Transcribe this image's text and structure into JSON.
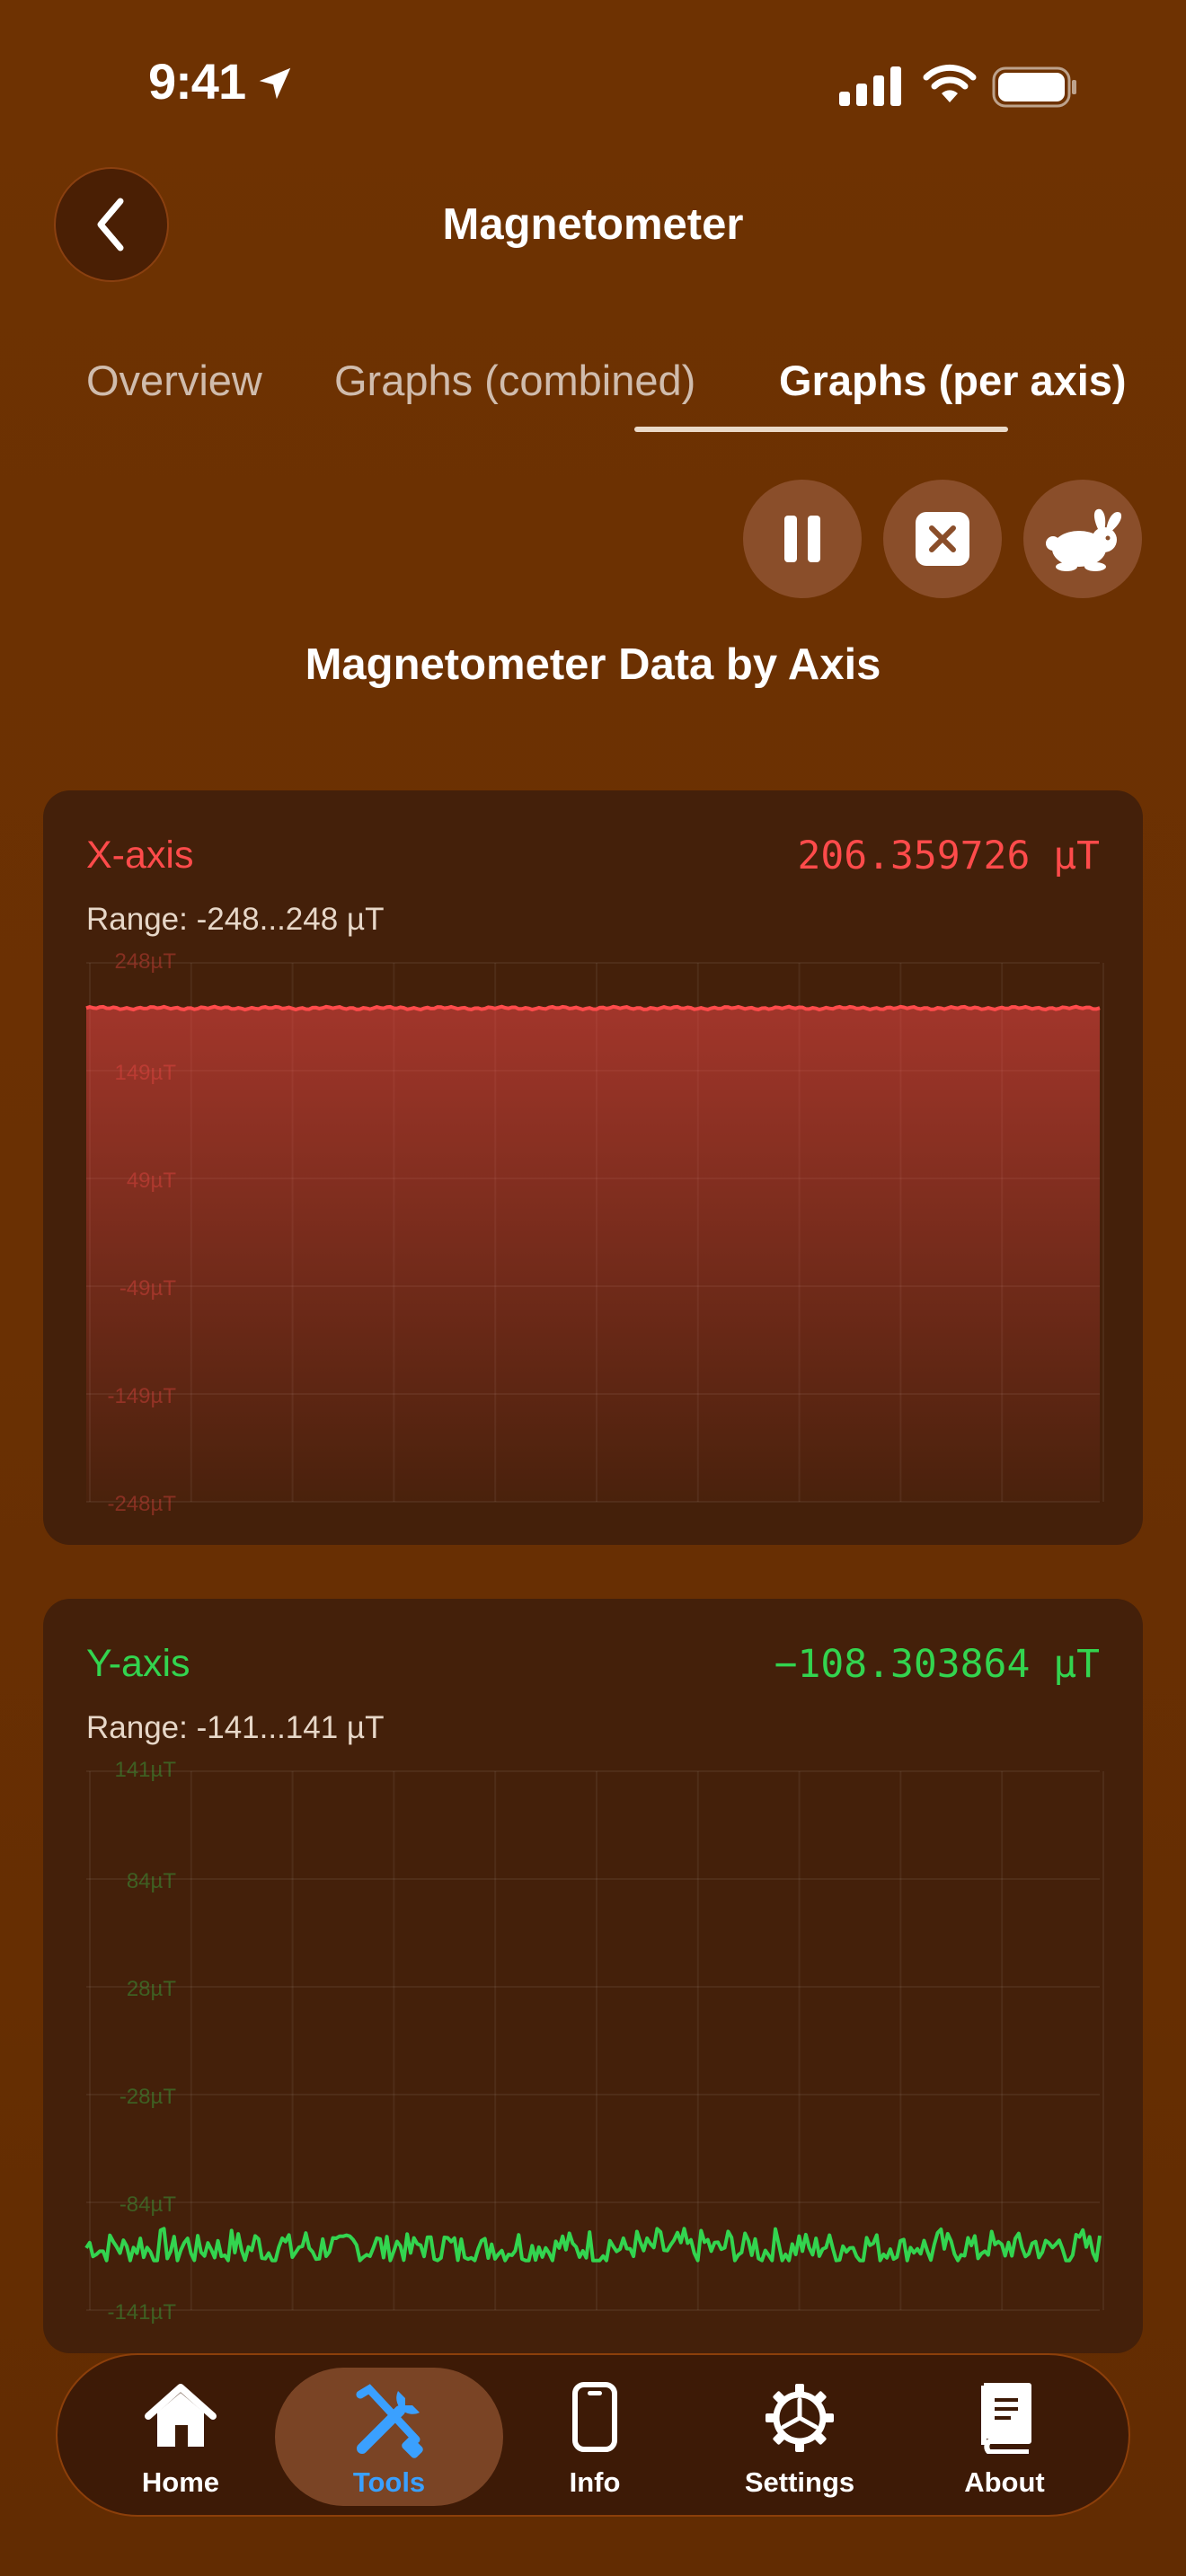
{
  "status_bar": {
    "time": "9:41"
  },
  "nav": {
    "title": "Magnetometer"
  },
  "tabs": [
    {
      "label": "Overview",
      "active": false
    },
    {
      "label": "Graphs (combined)",
      "active": false
    },
    {
      "label": "Graphs (per axis)",
      "active": true
    }
  ],
  "actions": {
    "pause_icon": "pause-icon",
    "clear_icon": "clear-icon",
    "speed_icon": "rabbit-icon"
  },
  "section_title": "Magnetometer Data by Axis",
  "axes": [
    {
      "name": "X-axis",
      "value": "206.359726 µT",
      "range": "Range: -248...248 µT",
      "color": "#ff4b4b",
      "ticks": [
        "248µT",
        "149µT",
        "49µT",
        "-49µT",
        "-149µT",
        "-248µT"
      ]
    },
    {
      "name": "Y-axis",
      "value": "−108.303864 µT",
      "range": "Range: -141...141 µT",
      "color": "#33d44f",
      "ticks": [
        "141µT",
        "84µT",
        "28µT",
        "-28µT",
        "-84µT",
        "-141µT"
      ]
    }
  ],
  "chart_data": [
    {
      "type": "area",
      "series": [
        {
          "name": "X-axis",
          "level": 206.36
        }
      ],
      "ylim": [
        -248,
        248
      ]
    },
    {
      "type": "line",
      "series": [
        {
          "name": "Y-axis",
          "mean": -108.3,
          "min": -115,
          "max": -98
        }
      ],
      "ylim": [
        -141,
        141
      ]
    }
  ],
  "tabbar": [
    {
      "label": "Home",
      "icon": "home-icon",
      "selected": false
    },
    {
      "label": "Tools",
      "icon": "tools-icon",
      "selected": true
    },
    {
      "label": "Info",
      "icon": "phone-icon",
      "selected": false
    },
    {
      "label": "Settings",
      "icon": "gear-icon",
      "selected": false
    },
    {
      "label": "About",
      "icon": "book-icon",
      "selected": false
    }
  ],
  "colors": {
    "accent": "#3aa0ff",
    "background": "#6e3202",
    "card": "#44200a"
  }
}
